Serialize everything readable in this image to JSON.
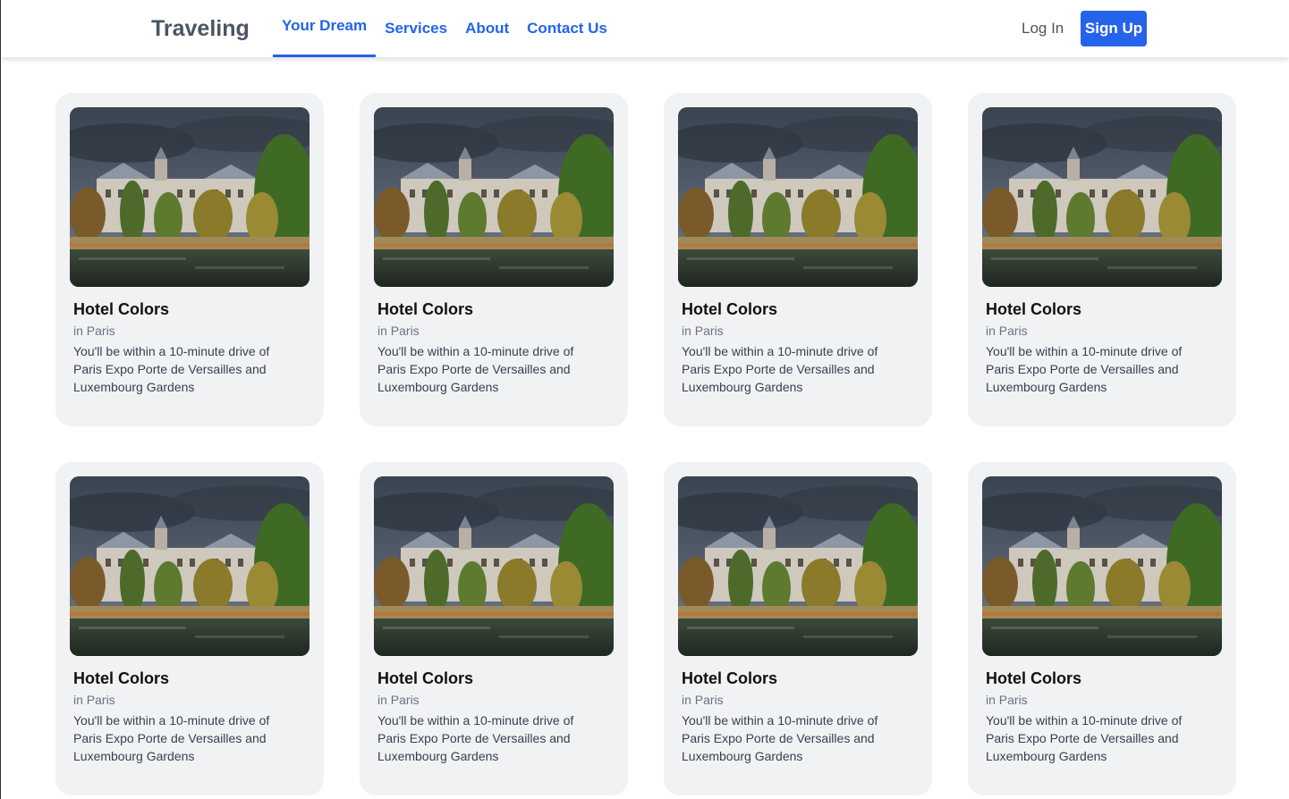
{
  "header": {
    "brand": "Traveling",
    "nav": [
      {
        "label": "Your Dream",
        "active": true
      },
      {
        "label": "Services",
        "active": false
      },
      {
        "label": "About",
        "active": false
      },
      {
        "label": "Contact Us",
        "active": false
      }
    ],
    "login": "Log In",
    "signup": "Sign Up"
  },
  "colors": {
    "accent": "#2563eb",
    "card_bg": "#f1f2f4"
  },
  "cards": [
    {
      "title": "Hotel Colors",
      "location": "in Paris",
      "description": "You'll be within a 10-minute drive of Paris Expo Porte de Versailles and Luxembourg Gardens",
      "image": "hotel-photo"
    },
    {
      "title": "Hotel Colors",
      "location": "in Paris",
      "description": "You'll be within a 10-minute drive of Paris Expo Porte de Versailles and Luxembourg Gardens",
      "image": "hotel-photo"
    },
    {
      "title": "Hotel Colors",
      "location": "in Paris",
      "description": "You'll be within a 10-minute drive of Paris Expo Porte de Versailles and Luxembourg Gardens",
      "image": "hotel-photo"
    },
    {
      "title": "Hotel Colors",
      "location": "in Paris",
      "description": "You'll be within a 10-minute drive of Paris Expo Porte de Versailles and Luxembourg Gardens",
      "image": "hotel-photo"
    },
    {
      "title": "Hotel Colors",
      "location": "in Paris",
      "description": "You'll be within a 10-minute drive of Paris Expo Porte de Versailles and Luxembourg Gardens",
      "image": "hotel-photo"
    },
    {
      "title": "Hotel Colors",
      "location": "in Paris",
      "description": "You'll be within a 10-minute drive of Paris Expo Porte de Versailles and Luxembourg Gardens",
      "image": "hotel-photo"
    },
    {
      "title": "Hotel Colors",
      "location": "in Paris",
      "description": "You'll be within a 10-minute drive of Paris Expo Porte de Versailles and Luxembourg Gardens",
      "image": "hotel-photo"
    },
    {
      "title": "Hotel Colors",
      "location": "in Paris",
      "description": "You'll be within a 10-minute drive of Paris Expo Porte de Versailles and Luxembourg Gardens",
      "image": "hotel-photo"
    }
  ]
}
